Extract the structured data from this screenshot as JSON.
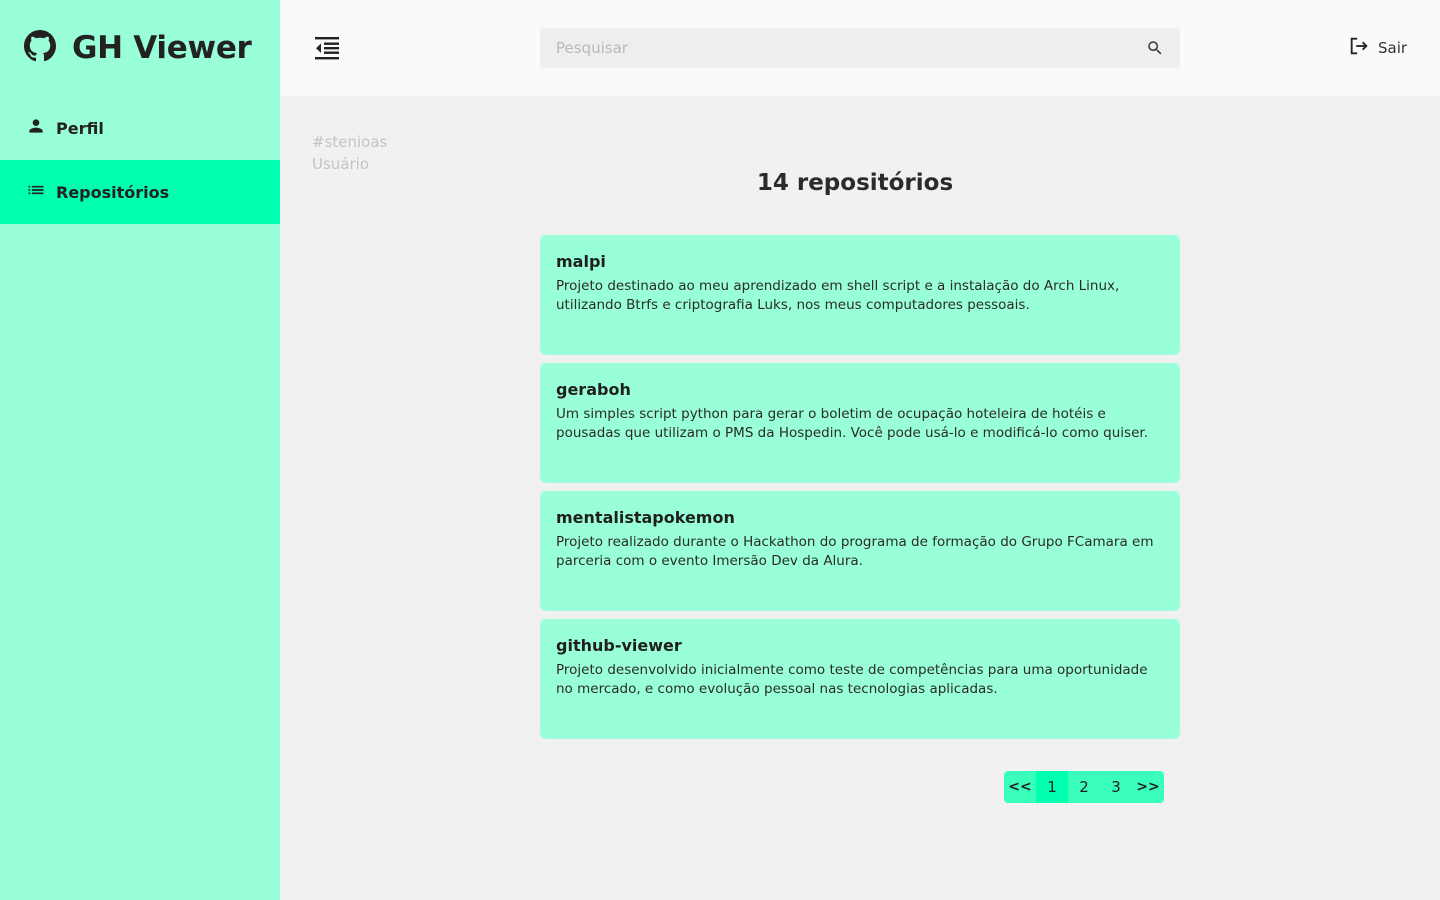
{
  "app": {
    "title": "GH Viewer"
  },
  "sidebar": {
    "items": [
      {
        "label": "Perfil",
        "icon": "person-icon",
        "active": false
      },
      {
        "label": "Repositórios",
        "icon": "list-icon",
        "active": true
      }
    ]
  },
  "header": {
    "search_placeholder": "Pesquisar",
    "logout_label": "Sair"
  },
  "user": {
    "handle": "#stenioas",
    "role": "Usuário"
  },
  "repos": {
    "count_label": "14 repositórios",
    "items": [
      {
        "name": "malpi",
        "description": "Projeto destinado ao meu aprendizado em shell script e a instalação do Arch Linux, utilizando Btrfs e criptografia Luks, nos meus computadores pessoais."
      },
      {
        "name": "geraboh",
        "description": "Um simples script python para gerar o boletim de ocupação hoteleira de hotéis e pousadas que utilizam o PMS da Hospedin. Você pode usá-lo e modificá-lo como quiser."
      },
      {
        "name": "mentalistapokemon",
        "description": "Projeto realizado durante o Hackathon do programa de formação do Grupo FCamara em parceria com o evento Imersão Dev da Alura."
      },
      {
        "name": "github-viewer",
        "description": "Projeto desenvolvido inicialmente como teste de competências para uma oportunidade no mercado, e como evolução pessoal nas tecnologias aplicadas."
      }
    ]
  },
  "pagination": {
    "first": "<<",
    "pages": [
      "1",
      "2",
      "3"
    ],
    "current": "1",
    "last": ">>"
  },
  "colors": {
    "sidebar_bg": "#99ffd8",
    "accent": "#00ffae",
    "card_bg": "#99ffd8",
    "page_bg": "#f1f1f1"
  }
}
